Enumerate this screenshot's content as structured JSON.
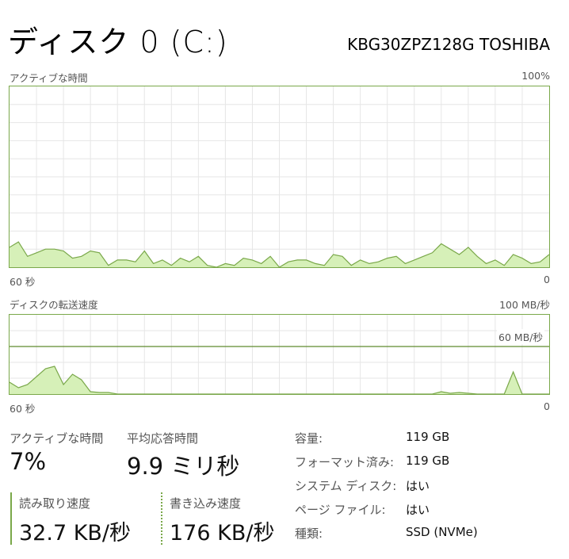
{
  "header": {
    "title": "ディスク 0 (C:)",
    "model": "KBG30ZPZ128G TOSHIBA"
  },
  "active_time_graph": {
    "label": "アクティブな時間",
    "max_label": "100%",
    "time_left_label": "60 秒",
    "time_right_label": "0"
  },
  "transfer_graph": {
    "label": "ディスクの転送速度",
    "max_label": "100 MB/秒",
    "threshold_label": "60 MB/秒",
    "time_left_label": "60 秒",
    "time_right_label": "0"
  },
  "stats": {
    "active_time": {
      "label": "アクティブな時間",
      "value": "7%"
    },
    "avg_response": {
      "label": "平均応答時間",
      "value": "9.9 ミリ秒"
    },
    "read_speed": {
      "label": "読み取り速度",
      "value": "32.7 KB/秒"
    },
    "write_speed": {
      "label": "書き込み速度",
      "value": "176 KB/秒"
    }
  },
  "properties": [
    {
      "label": "容量:",
      "value": "119 GB"
    },
    {
      "label": "フォーマット済み:",
      "value": "119 GB"
    },
    {
      "label": "システム ディスク:",
      "value": "はい"
    },
    {
      "label": "ページ ファイル:",
      "value": "はい"
    },
    {
      "label": "種類:",
      "value": "SSD (NVMe)"
    }
  ],
  "colors": {
    "accent": "#7aa84a",
    "fill": "#d6f0b8",
    "grid": "#e6e6e6"
  },
  "chart_data": [
    {
      "type": "area",
      "y_unit": "%",
      "ylim": [
        0,
        100
      ],
      "x": [
        60,
        59,
        58,
        57,
        56,
        55,
        54,
        53,
        52,
        51,
        50,
        49,
        48,
        47,
        46,
        45,
        44,
        43,
        42,
        41,
        40,
        39,
        38,
        37,
        36,
        35,
        34,
        33,
        32,
        31,
        30,
        29,
        28,
        27,
        26,
        25,
        24,
        23,
        22,
        21,
        20,
        19,
        18,
        17,
        16,
        15,
        14,
        13,
        12,
        11,
        10,
        9,
        8,
        7,
        6,
        5,
        4,
        3,
        2,
        1,
        0
      ],
      "values": [
        11,
        14,
        6,
        8,
        10,
        10,
        9,
        5,
        6,
        9,
        8,
        1,
        4,
        4,
        3,
        9,
        2,
        4,
        1,
        5,
        3,
        6,
        1,
        0,
        2,
        1,
        5,
        4,
        2,
        6,
        0,
        3,
        4,
        4,
        2,
        1,
        7,
        6,
        1,
        4,
        2,
        3,
        5,
        6,
        2,
        4,
        6,
        8,
        13,
        10,
        7,
        11,
        6,
        2,
        4,
        1,
        7,
        5,
        2,
        3,
        7
      ],
      "grid": true
    },
    {
      "type": "area",
      "y_unit": "MB/秒",
      "ylim": [
        0,
        100
      ],
      "threshold": 60,
      "x": [
        60,
        59,
        58,
        57,
        56,
        55,
        54,
        53,
        52,
        51,
        50,
        49,
        48,
        47,
        46,
        45,
        44,
        43,
        42,
        41,
        40,
        39,
        38,
        37,
        36,
        35,
        34,
        33,
        32,
        31,
        30,
        29,
        28,
        27,
        26,
        25,
        24,
        23,
        22,
        21,
        20,
        19,
        18,
        17,
        16,
        15,
        14,
        13,
        12,
        11,
        10,
        9,
        8,
        7,
        6,
        5,
        4,
        3,
        2,
        1,
        0
      ],
      "series": [
        {
          "values": [
            15,
            8,
            12,
            22,
            32,
            35,
            12,
            25,
            18,
            3,
            2,
            2,
            0,
            0,
            0,
            0,
            0,
            0,
            0,
            0,
            0,
            0,
            0,
            0,
            0,
            0,
            0,
            0,
            0,
            0,
            0,
            0,
            0,
            0,
            0,
            0,
            0,
            0,
            0,
            0,
            0,
            0,
            0,
            0,
            0,
            0,
            0,
            0,
            3,
            1,
            2,
            1,
            0,
            0,
            0,
            0,
            28,
            0,
            0,
            0,
            0
          ]
        }
      ],
      "grid": true
    }
  ]
}
